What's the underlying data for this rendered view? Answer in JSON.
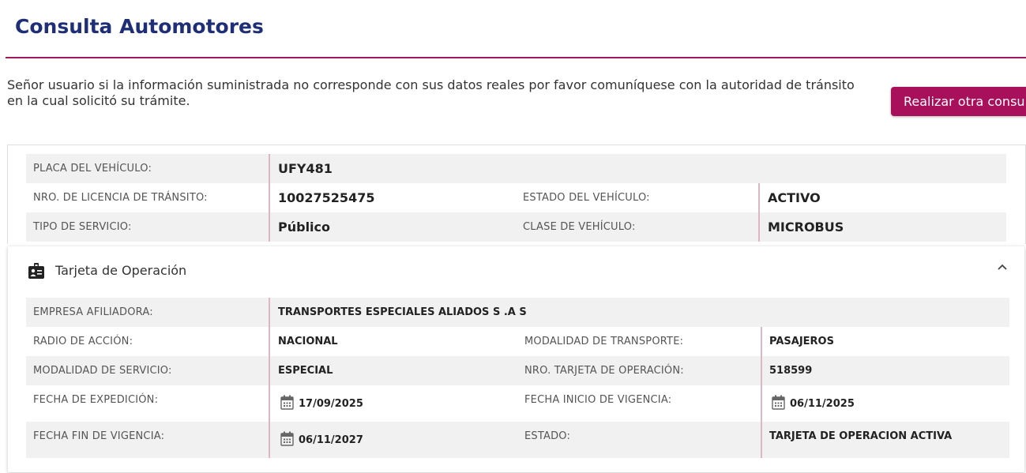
{
  "header": {
    "title": "Consulta Automotores"
  },
  "notice": {
    "text": "Señor usuario si la información suministrada no corresponde con sus datos reales por favor comuníquese con la autoridad de tránsito en la cual solicitó su trámite."
  },
  "actions": {
    "new_query_label": "Realizar otra consul"
  },
  "vehicle": {
    "plate_label": "PLACA DEL VEHÍCULO:",
    "plate_value": "UFY481",
    "license_label": "NRO. DE LICENCIA DE TRÁNSITO:",
    "license_value": "10027525475",
    "status_label": "ESTADO DEL VEHÍCULO:",
    "status_value": "ACTIVO",
    "service_label": "TIPO DE SERVICIO:",
    "service_value": "Público",
    "class_label": "CLASE DE VEHÍCULO:",
    "class_value": "MICROBUS"
  },
  "operation_card": {
    "title": "Tarjeta de Operación",
    "icon": "id-badge-icon",
    "company_label": "EMPRESA AFILIADORA:",
    "company_value": "TRANSPORTES ESPECIALES ALIADOS S .A S",
    "radius_label": "RADIO DE ACCIÓN:",
    "radius_value": "NACIONAL",
    "transport_mode_label": "MODALIDAD DE TRANSPORTE:",
    "transport_mode_value": "PASAJEROS",
    "service_mode_label": "MODALIDAD DE SERVICIO:",
    "service_mode_value": "ESPECIAL",
    "card_number_label": "NRO. TARJETA DE OPERACIÓN:",
    "card_number_value": "518599",
    "issue_date_label": "FECHA DE EXPEDICIÓN:",
    "issue_date_value": "17/09/2025",
    "start_date_label": "FECHA INICIO DE VIGENCIA:",
    "start_date_value": "06/11/2025",
    "end_date_label": "FECHA FIN DE VIGENCIA:",
    "end_date_value": "06/11/2027",
    "state_label": "ESTADO:",
    "state_value": "TARJETA DE OPERACION ACTIVA"
  },
  "colors": {
    "brand_blue": "#1f2f77",
    "accent": "#a8105c"
  }
}
